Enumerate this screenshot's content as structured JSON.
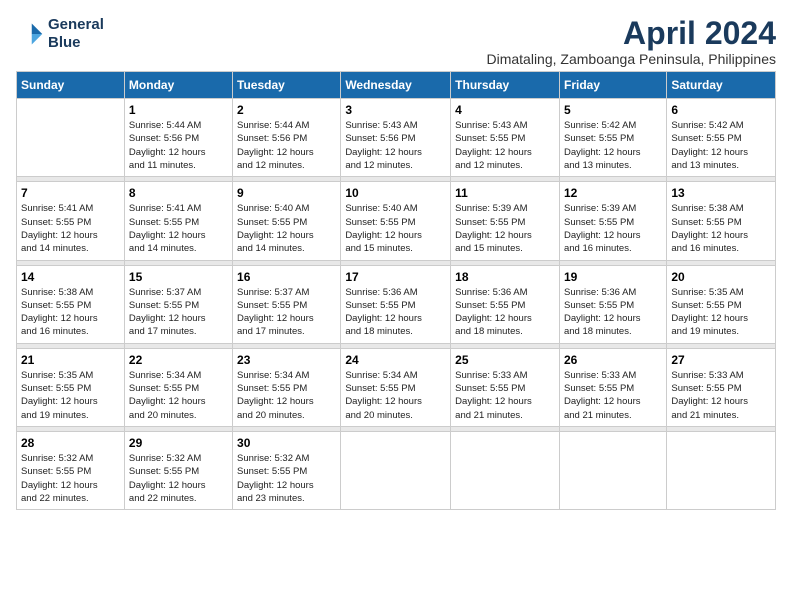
{
  "logo": {
    "line1": "General",
    "line2": "Blue"
  },
  "title": "April 2024",
  "location": "Dimataling, Zamboanga Peninsula, Philippines",
  "days_of_week": [
    "Sunday",
    "Monday",
    "Tuesday",
    "Wednesday",
    "Thursday",
    "Friday",
    "Saturday"
  ],
  "weeks": [
    [
      {
        "num": "",
        "info": ""
      },
      {
        "num": "1",
        "info": "Sunrise: 5:44 AM\nSunset: 5:56 PM\nDaylight: 12 hours\nand 11 minutes."
      },
      {
        "num": "2",
        "info": "Sunrise: 5:44 AM\nSunset: 5:56 PM\nDaylight: 12 hours\nand 12 minutes."
      },
      {
        "num": "3",
        "info": "Sunrise: 5:43 AM\nSunset: 5:56 PM\nDaylight: 12 hours\nand 12 minutes."
      },
      {
        "num": "4",
        "info": "Sunrise: 5:43 AM\nSunset: 5:55 PM\nDaylight: 12 hours\nand 12 minutes."
      },
      {
        "num": "5",
        "info": "Sunrise: 5:42 AM\nSunset: 5:55 PM\nDaylight: 12 hours\nand 13 minutes."
      },
      {
        "num": "6",
        "info": "Sunrise: 5:42 AM\nSunset: 5:55 PM\nDaylight: 12 hours\nand 13 minutes."
      }
    ],
    [
      {
        "num": "7",
        "info": "Sunrise: 5:41 AM\nSunset: 5:55 PM\nDaylight: 12 hours\nand 14 minutes."
      },
      {
        "num": "8",
        "info": "Sunrise: 5:41 AM\nSunset: 5:55 PM\nDaylight: 12 hours\nand 14 minutes."
      },
      {
        "num": "9",
        "info": "Sunrise: 5:40 AM\nSunset: 5:55 PM\nDaylight: 12 hours\nand 14 minutes."
      },
      {
        "num": "10",
        "info": "Sunrise: 5:40 AM\nSunset: 5:55 PM\nDaylight: 12 hours\nand 15 minutes."
      },
      {
        "num": "11",
        "info": "Sunrise: 5:39 AM\nSunset: 5:55 PM\nDaylight: 12 hours\nand 15 minutes."
      },
      {
        "num": "12",
        "info": "Sunrise: 5:39 AM\nSunset: 5:55 PM\nDaylight: 12 hours\nand 16 minutes."
      },
      {
        "num": "13",
        "info": "Sunrise: 5:38 AM\nSunset: 5:55 PM\nDaylight: 12 hours\nand 16 minutes."
      }
    ],
    [
      {
        "num": "14",
        "info": "Sunrise: 5:38 AM\nSunset: 5:55 PM\nDaylight: 12 hours\nand 16 minutes."
      },
      {
        "num": "15",
        "info": "Sunrise: 5:37 AM\nSunset: 5:55 PM\nDaylight: 12 hours\nand 17 minutes."
      },
      {
        "num": "16",
        "info": "Sunrise: 5:37 AM\nSunset: 5:55 PM\nDaylight: 12 hours\nand 17 minutes."
      },
      {
        "num": "17",
        "info": "Sunrise: 5:36 AM\nSunset: 5:55 PM\nDaylight: 12 hours\nand 18 minutes."
      },
      {
        "num": "18",
        "info": "Sunrise: 5:36 AM\nSunset: 5:55 PM\nDaylight: 12 hours\nand 18 minutes."
      },
      {
        "num": "19",
        "info": "Sunrise: 5:36 AM\nSunset: 5:55 PM\nDaylight: 12 hours\nand 18 minutes."
      },
      {
        "num": "20",
        "info": "Sunrise: 5:35 AM\nSunset: 5:55 PM\nDaylight: 12 hours\nand 19 minutes."
      }
    ],
    [
      {
        "num": "21",
        "info": "Sunrise: 5:35 AM\nSunset: 5:55 PM\nDaylight: 12 hours\nand 19 minutes."
      },
      {
        "num": "22",
        "info": "Sunrise: 5:34 AM\nSunset: 5:55 PM\nDaylight: 12 hours\nand 20 minutes."
      },
      {
        "num": "23",
        "info": "Sunrise: 5:34 AM\nSunset: 5:55 PM\nDaylight: 12 hours\nand 20 minutes."
      },
      {
        "num": "24",
        "info": "Sunrise: 5:34 AM\nSunset: 5:55 PM\nDaylight: 12 hours\nand 20 minutes."
      },
      {
        "num": "25",
        "info": "Sunrise: 5:33 AM\nSunset: 5:55 PM\nDaylight: 12 hours\nand 21 minutes."
      },
      {
        "num": "26",
        "info": "Sunrise: 5:33 AM\nSunset: 5:55 PM\nDaylight: 12 hours\nand 21 minutes."
      },
      {
        "num": "27",
        "info": "Sunrise: 5:33 AM\nSunset: 5:55 PM\nDaylight: 12 hours\nand 21 minutes."
      }
    ],
    [
      {
        "num": "28",
        "info": "Sunrise: 5:32 AM\nSunset: 5:55 PM\nDaylight: 12 hours\nand 22 minutes."
      },
      {
        "num": "29",
        "info": "Sunrise: 5:32 AM\nSunset: 5:55 PM\nDaylight: 12 hours\nand 22 minutes."
      },
      {
        "num": "30",
        "info": "Sunrise: 5:32 AM\nSunset: 5:55 PM\nDaylight: 12 hours\nand 23 minutes."
      },
      {
        "num": "",
        "info": ""
      },
      {
        "num": "",
        "info": ""
      },
      {
        "num": "",
        "info": ""
      },
      {
        "num": "",
        "info": ""
      }
    ]
  ]
}
